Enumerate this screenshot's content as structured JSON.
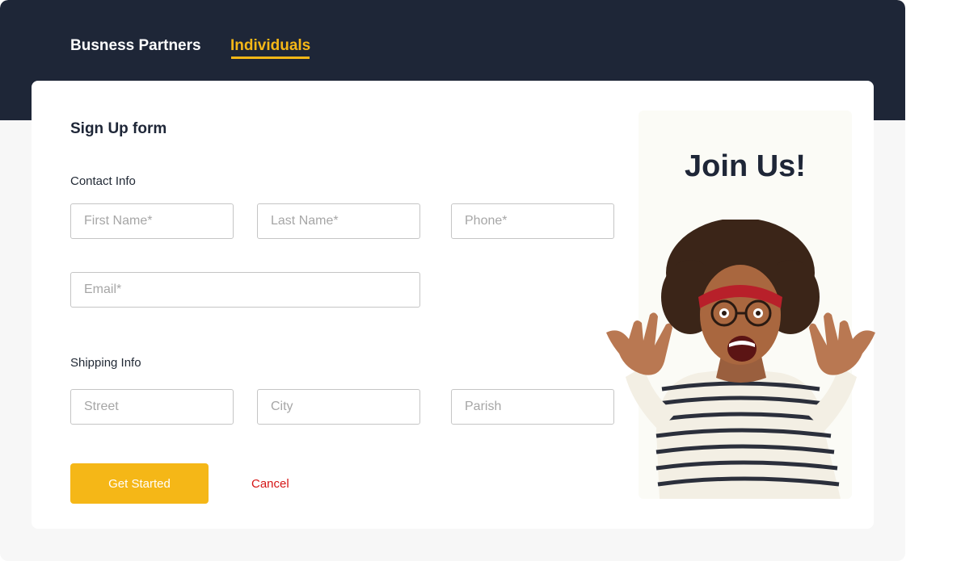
{
  "tabs": {
    "business_partners": "Busness Partners",
    "individuals": "Individuals"
  },
  "form": {
    "title": "Sign Up form",
    "contact_label": "Contact Info",
    "shipping_label": "Shipping Info",
    "first_name_placeholder": "First Name*",
    "last_name_placeholder": "Last Name*",
    "phone_placeholder": "Phone*",
    "email_placeholder": "Email*",
    "street_placeholder": "Street",
    "city_placeholder": "City",
    "parish_placeholder": "Parish",
    "submit_label": "Get Started",
    "cancel_label": "Cancel"
  },
  "promo": {
    "title": "Join Us!"
  },
  "colors": {
    "header_bg": "#1e2637",
    "accent": "#f5b717",
    "cancel": "#d51515"
  }
}
